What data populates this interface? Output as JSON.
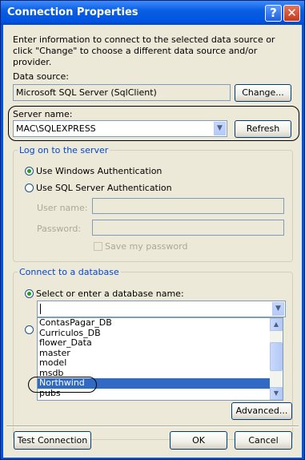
{
  "window": {
    "title": "Connection Properties",
    "help_glyph": "?",
    "close_glyph": "✕"
  },
  "intro_text": "Enter information to connect to the selected data source or click \"Change\" to choose a different data source and/or provider.",
  "data_source": {
    "label": "Data source:",
    "value": "Microsoft SQL Server (SqlClient)",
    "change_button": "Change..."
  },
  "server": {
    "label": "Server name:",
    "value": "MAC\\SQLEXPRESS",
    "refresh_button": "Refresh"
  },
  "logon": {
    "group_title": "Log on to the server",
    "windows_auth": "Use Windows Authentication",
    "sql_auth": "Use SQL Server Authentication",
    "selected": "windows",
    "username_label": "User name:",
    "password_label": "Password:",
    "save_password": "Save my password"
  },
  "database": {
    "group_title": "Connect to a database",
    "select_option": "Select or enter a database name:",
    "input_value": "",
    "options": [
      "ContasPagar_DB",
      "Curriculos_DB",
      "flower_Data",
      "master",
      "model",
      "msdb",
      "Northwind",
      "pubs"
    ],
    "selected": "Northwind"
  },
  "buttons": {
    "advanced": "Advanced...",
    "test": "Test Connection",
    "ok": "OK",
    "cancel": "Cancel"
  }
}
